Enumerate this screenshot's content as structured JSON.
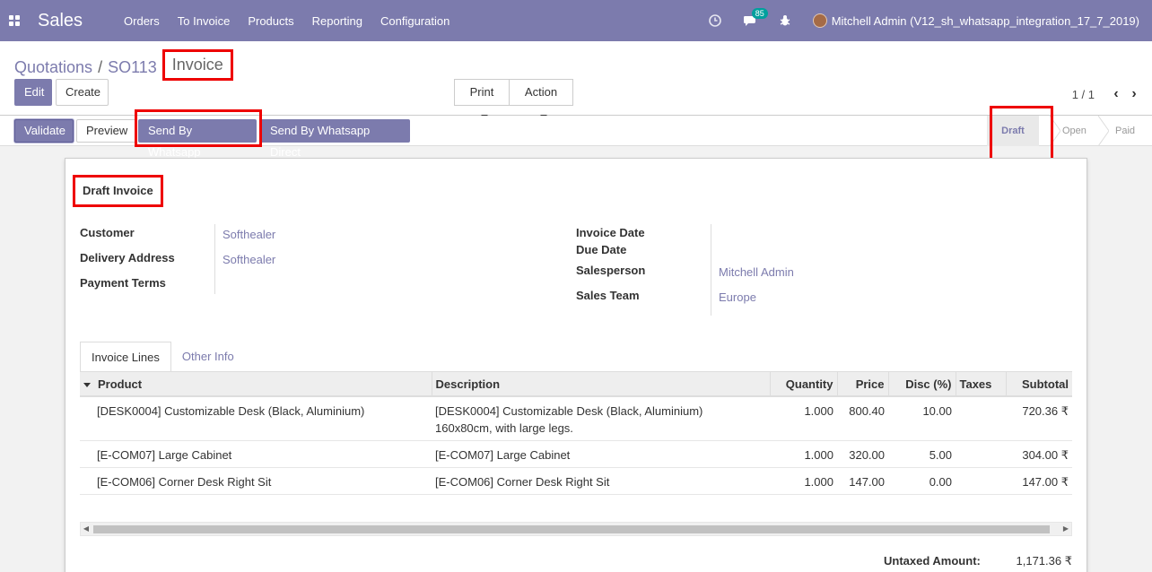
{
  "navbar": {
    "brand": "Sales",
    "menu": [
      "Orders",
      "To Invoice",
      "Products",
      "Reporting",
      "Configuration"
    ],
    "chat_badge": "85",
    "user_name": "Mitchell Admin (V12_sh_whatsapp_integration_17_7_2019)"
  },
  "control_panel": {
    "breadcrumb": [
      "Quotations",
      "SO113"
    ],
    "current": "Invoice",
    "edit_label": "Edit",
    "create_label": "Create",
    "print_label": "Print",
    "action_label": "Action",
    "pager": "1 / 1"
  },
  "statusbar": {
    "buttons": [
      "Validate",
      "Preview",
      "Send By Whatsapp",
      "Send By Whatsapp Direct"
    ],
    "states": [
      "Draft",
      "Open",
      "Paid"
    ],
    "active_state": "Draft"
  },
  "sheet": {
    "title": "Draft Invoice",
    "fields_left": [
      {
        "label": "Customer",
        "value": "Softhealer"
      },
      {
        "label": "Delivery Address",
        "value": "Softhealer"
      },
      {
        "label": "Payment Terms",
        "value": ""
      }
    ],
    "fields_right": [
      {
        "label": "Invoice Date",
        "value": ""
      },
      {
        "label": "Due Date",
        "value": ""
      },
      {
        "label": "Salesperson",
        "value": "Mitchell Admin"
      },
      {
        "label": "Sales Team",
        "value": "Europe"
      }
    ],
    "tabs": [
      "Invoice Lines",
      "Other Info"
    ],
    "columns": [
      "Product",
      "Description",
      "Quantity",
      "Price",
      "Disc (%)",
      "Taxes",
      "Subtotal"
    ],
    "lines": [
      {
        "product": "[DESK0004] Customizable Desk (Black, Aluminium)",
        "description": "[DESK0004] Customizable Desk (Black, Aluminium)",
        "description2": "160x80cm, with large legs.",
        "quantity": "1.000",
        "price": "800.40",
        "disc": "10.00",
        "taxes": "",
        "subtotal": "720.36 ₹"
      },
      {
        "product": "[E-COM07] Large Cabinet",
        "description": "[E-COM07] Large Cabinet",
        "description2": "",
        "quantity": "1.000",
        "price": "320.00",
        "disc": "5.00",
        "taxes": "",
        "subtotal": "304.00 ₹"
      },
      {
        "product": "[E-COM06] Corner Desk Right Sit",
        "description": "[E-COM06] Corner Desk Right Sit",
        "description2": "",
        "quantity": "1.000",
        "price": "147.00",
        "disc": "0.00",
        "taxes": "",
        "subtotal": "147.00 ₹"
      }
    ],
    "untaxed_label": "Untaxed Amount:",
    "untaxed_value": "1,171.36 ₹"
  },
  "colors": {
    "brand": "#7c7bad",
    "highlight": "#ee0000",
    "teal_badge": "#00a09d"
  }
}
